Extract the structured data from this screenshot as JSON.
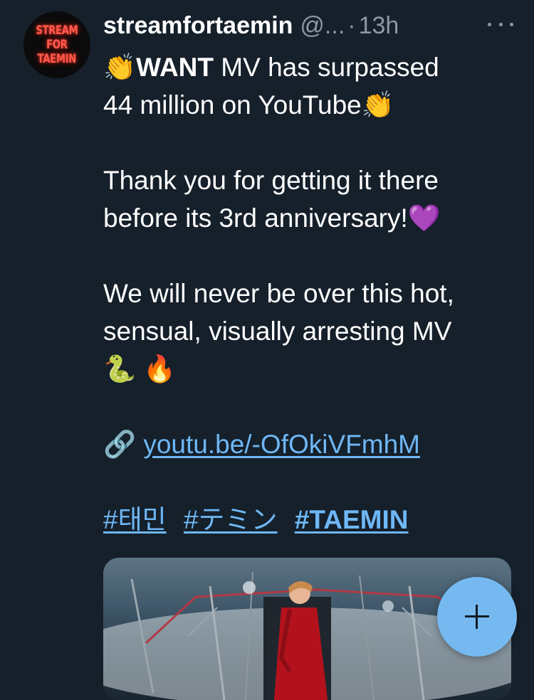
{
  "avatar": {
    "lines": [
      "STREAM",
      "FOR",
      "TAEMIN"
    ]
  },
  "header": {
    "display_name": "streamfortaemin",
    "handle": "@...",
    "separator": "·",
    "time": "13h"
  },
  "menu": {
    "icon": "more-dots-icon"
  },
  "body": {
    "clap_emoji": "👏",
    "bold_word": "WANT",
    "line1_rest": " MV has surpassed",
    "line2": "44 million on YouTube",
    "line3": "Thank you for getting it there",
    "line4": "before its 3rd anniversary!",
    "heart_emoji": "💜",
    "line5": "We will never be over this hot,",
    "line6": "sensual, visually arresting MV",
    "snake_emoji": "🐍",
    "fire_emoji": "🔥",
    "link_emoji": "🔗",
    "link_text": "youtu.be/-OfOkiVFmhM",
    "hashtags": [
      "#태민",
      "#テミン",
      "#TAEMIN"
    ]
  },
  "media": {
    "alt": "WANT music video still"
  },
  "compose": {
    "icon": "plus-icon"
  }
}
